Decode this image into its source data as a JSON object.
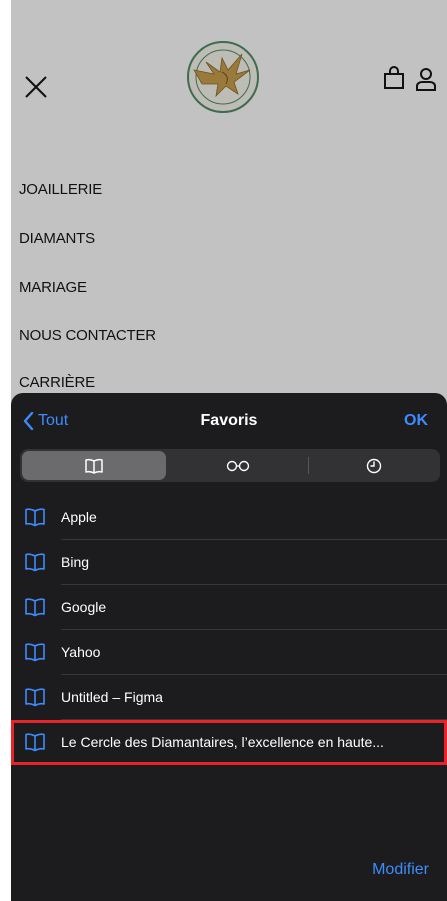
{
  "menu": {
    "items": [
      "JOAILLERIE",
      "DIAMANTS",
      "MARIAGE",
      "NOUS CONTACTER",
      "CARRIÈRE"
    ]
  },
  "logo": {
    "top_text": "LE CERCLE DES DIAMANTAIRES",
    "bottom_text": "ANVERS"
  },
  "sheet": {
    "back_label": "Tout",
    "title": "Favoris",
    "ok_label": "OK",
    "tabs": [
      {
        "icon": "book-icon",
        "selected": true
      },
      {
        "icon": "reading-list-glasses-icon",
        "selected": false
      },
      {
        "icon": "history-clock-icon",
        "selected": false
      }
    ],
    "bookmarks": [
      "Apple",
      "Bing",
      "Google",
      "Yahoo",
      "Untitled – Figma",
      "Le Cercle des Diamantaires, l’excellence en haute..."
    ],
    "modify_label": "Modifier"
  },
  "colors": {
    "accent": "#3d8bfd",
    "sheet_bg": "#1c1c1e",
    "page_bg": "#c2c2c2",
    "highlight": "#e8232a"
  }
}
